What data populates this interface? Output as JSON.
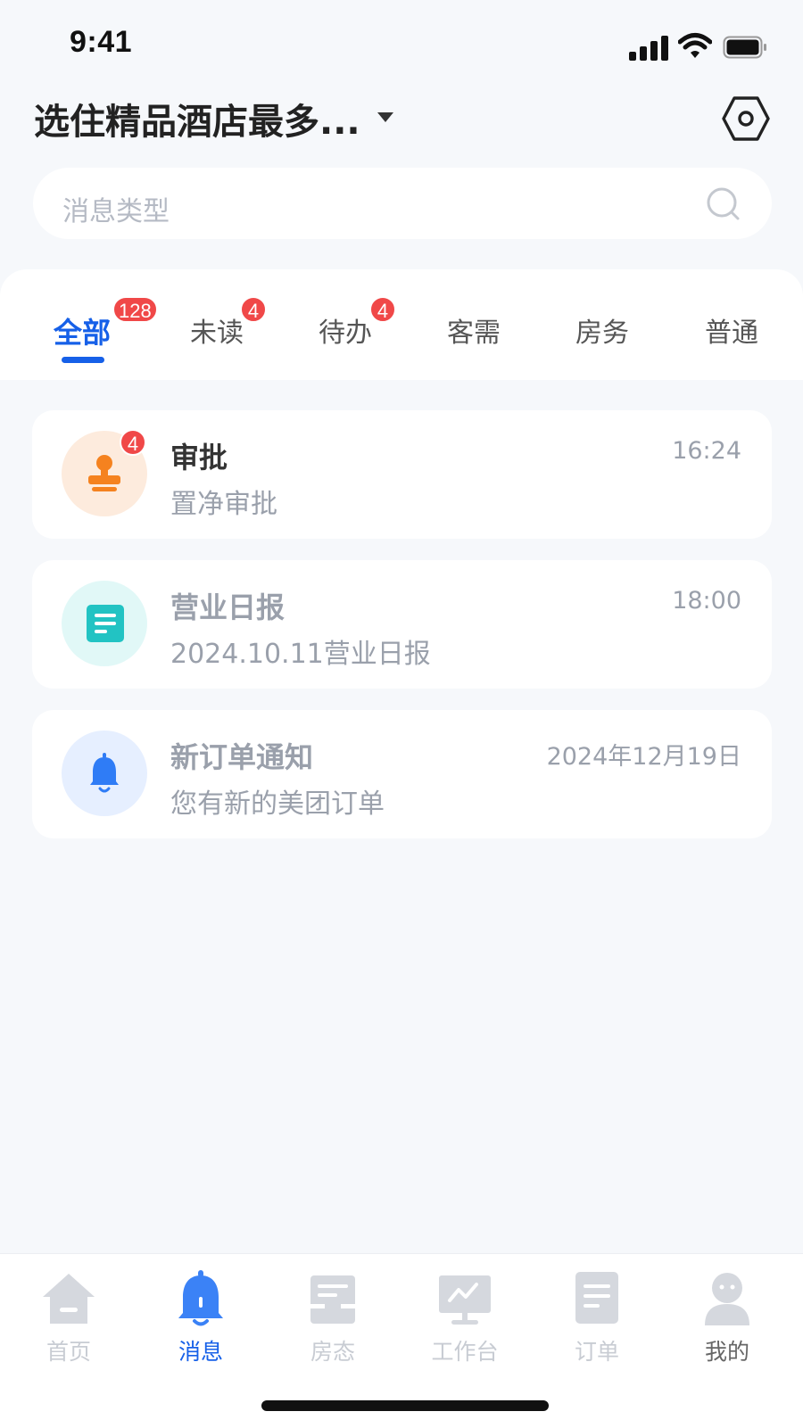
{
  "status_bar": {
    "time": "9:41"
  },
  "header": {
    "hotel_name": "选住精品酒店最多..."
  },
  "search": {
    "placeholder": "消息类型"
  },
  "tabs": [
    {
      "label": "全部",
      "badge": "128",
      "active": true
    },
    {
      "label": "未读",
      "badge": "4"
    },
    {
      "label": "待办",
      "badge": "4"
    },
    {
      "label": "客需"
    },
    {
      "label": "房务"
    },
    {
      "label": "普通"
    }
  ],
  "messages": [
    {
      "title": "审批",
      "subtitle": "置净审批",
      "time": "16:24",
      "badge": "4",
      "icon": "stamp-icon",
      "title_color": "#333333",
      "avatar_bg": "#fdebdd",
      "icon_color": "#f5821f"
    },
    {
      "title": "营业日报",
      "subtitle": "2024.10.11营业日报",
      "time": "18:00",
      "icon": "report-icon",
      "title_color": "#9aa0ab",
      "avatar_bg": "#e1f8f7",
      "icon_color": "#22c3c3"
    },
    {
      "title": "新订单通知",
      "subtitle": "您有新的美团订单",
      "time": "2024年12月19日",
      "icon": "bell-icon",
      "title_color": "#9aa0ab",
      "avatar_bg": "#e6efff",
      "icon_color": "#2f7cf6"
    }
  ],
  "bottom_nav": [
    {
      "label": "首页",
      "icon": "home-icon"
    },
    {
      "label": "消息",
      "icon": "bell-icon",
      "active": true
    },
    {
      "label": "房态",
      "icon": "room-status-icon"
    },
    {
      "label": "工作台",
      "icon": "workbench-icon"
    },
    {
      "label": "订单",
      "icon": "order-icon"
    },
    {
      "label": "我的",
      "icon": "profile-icon"
    }
  ],
  "colors": {
    "accent": "#1660e8",
    "badge": "#f04848",
    "background": "#f6f8fb"
  }
}
